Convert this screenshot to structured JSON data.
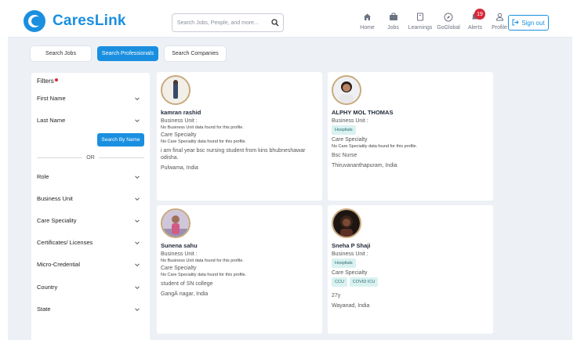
{
  "brand": {
    "name": "CaresLink",
    "accent": "#1a8fe0"
  },
  "search": {
    "placeholder": "Search Jobs, People, and more..."
  },
  "nav": [
    {
      "label": "Home",
      "icon": "home-icon"
    },
    {
      "label": "Jobs",
      "icon": "briefcase-icon"
    },
    {
      "label": "Learnings",
      "icon": "book-icon"
    },
    {
      "label": "GoGlobal",
      "icon": "compass-icon"
    },
    {
      "label": "Alerts",
      "icon": "bell-icon",
      "badge": "19"
    },
    {
      "label": "Profile",
      "icon": "user-icon"
    }
  ],
  "signout_label": "Sign out",
  "tabs": [
    {
      "label": "Search Jobs",
      "active": false
    },
    {
      "label": "Search Professionals",
      "active": true
    },
    {
      "label": "Search Companies",
      "active": false
    }
  ],
  "filters": {
    "title": "Filters",
    "first_name": "First Name",
    "last_name": "Last Name",
    "search_by_name": "Search By Name",
    "or": "OR",
    "items": [
      "Role",
      "Business Unit",
      "Care Speciality",
      "Certificates/ Licenses",
      "Micro-Credential",
      "Country",
      "State"
    ]
  },
  "cards": [
    {
      "name": "kamran rashid",
      "business_unit_label": "Business Unit :",
      "business_unit_note": "No Business Unit data found for this profile.",
      "care_label": "Care Specialty",
      "care_note": "No Care Speciality data found for this profile.",
      "bio": "i am final year bsc nursing student from kins bhubneshawar odisha.",
      "location": "Pulwama, India"
    },
    {
      "name": "ALPHY MOL THOMAS",
      "business_unit_label": "Business Unit :",
      "business_chips": [
        "Hospitals"
      ],
      "care_label": "Care Specialty",
      "care_note": "No Care Speciality data found for this profile.",
      "bio": "Bsc Nurse",
      "location": "Thiruvananthapuram, India"
    },
    {
      "name": "Sunena sahu",
      "business_unit_label": "Business Unit :",
      "business_unit_note": "No Business Unit data found for this profile.",
      "care_label": "Care Specialty",
      "care_note": "No Care Speciality data found for this profile.",
      "bio": "student of SN college",
      "location": "GangÄ nagar, India"
    },
    {
      "name": "Sneha P Shaji",
      "business_unit_label": "Business Unit :",
      "business_chips": [
        "Hospitals"
      ],
      "care_label": "Care Specialty",
      "care_chips": [
        "CCU",
        "COVID ICU"
      ],
      "bio": "27y",
      "location": "Wayanad, India"
    }
  ]
}
